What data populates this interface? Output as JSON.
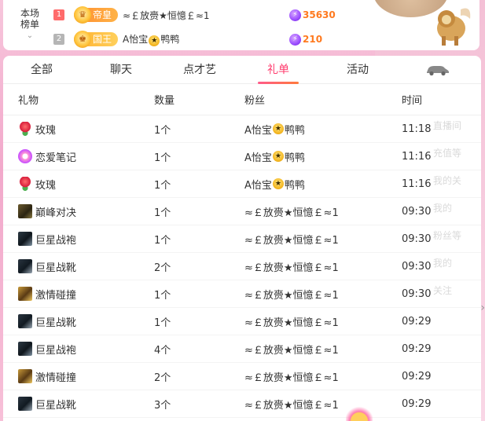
{
  "rank_card": {
    "label_line1": "本场",
    "label_line2": "榜单",
    "rows": [
      {
        "rank": "1",
        "title": "帝皇",
        "name": "≈￡放赍★恒憶￡≈1",
        "coins": "35630"
      },
      {
        "rank": "2",
        "title": "国王",
        "name_pre": "A怡宝",
        "name_post": "鸭鸭",
        "coins": "210"
      }
    ]
  },
  "tabs": [
    {
      "label": "全部"
    },
    {
      "label": "聊天"
    },
    {
      "label": "点才艺"
    },
    {
      "label": "礼单",
      "active": true
    },
    {
      "label": "活动"
    }
  ],
  "table": {
    "headers": {
      "gift": "礼物",
      "qty": "数量",
      "fan": "粉丝",
      "time": "时间"
    },
    "rows": [
      {
        "gift": "玫瑰",
        "icon": "rose",
        "qty": "1个",
        "fan_pre": "A怡宝",
        "fan_post": "鸭鸭",
        "time": "11:18"
      },
      {
        "gift": "恋爱笔记",
        "icon": "love-note",
        "qty": "1个",
        "fan_pre": "A怡宝",
        "fan_post": "鸭鸭",
        "time": "11:16"
      },
      {
        "gift": "玫瑰",
        "icon": "rose",
        "qty": "1个",
        "fan_pre": "A怡宝",
        "fan_post": "鸭鸭",
        "time": "11:16"
      },
      {
        "gift": "巅峰对决",
        "icon": "peak-duel",
        "qty": "1个",
        "fan": "≈￡放赍★恒憶￡≈1",
        "time": "09:30"
      },
      {
        "gift": "巨星战袍",
        "icon": "star-robe",
        "qty": "1个",
        "fan": "≈￡放赍★恒憶￡≈1",
        "time": "09:30"
      },
      {
        "gift": "巨星战靴",
        "icon": "star-boots",
        "qty": "2个",
        "fan": "≈￡放赍★恒憶￡≈1",
        "time": "09:30"
      },
      {
        "gift": "激情碰撞",
        "icon": "passion-clash",
        "qty": "1个",
        "fan": "≈￡放赍★恒憶￡≈1",
        "time": "09:30"
      },
      {
        "gift": "巨星战靴",
        "icon": "star-boots",
        "qty": "1个",
        "fan": "≈￡放赍★恒憶￡≈1",
        "time": "09:29"
      },
      {
        "gift": "巨星战袍",
        "icon": "star-robe",
        "qty": "4个",
        "fan": "≈￡放赍★恒憶￡≈1",
        "time": "09:29"
      },
      {
        "gift": "激情碰撞",
        "icon": "passion-clash",
        "qty": "2个",
        "fan": "≈￡放赍★恒憶￡≈1",
        "time": "09:29"
      },
      {
        "gift": "巨星战靴",
        "icon": "star-boots",
        "qty": "3个",
        "fan": "≈￡放赍★恒憶￡≈1",
        "time": "09:29"
      }
    ]
  },
  "side_ghost_items": [
    "直播间",
    "充值等",
    "我的关",
    "我的",
    "粉丝等",
    "我的",
    "关注"
  ],
  "colors": {
    "accent": "#ff3c6e",
    "coins": "#ff7a1f"
  }
}
